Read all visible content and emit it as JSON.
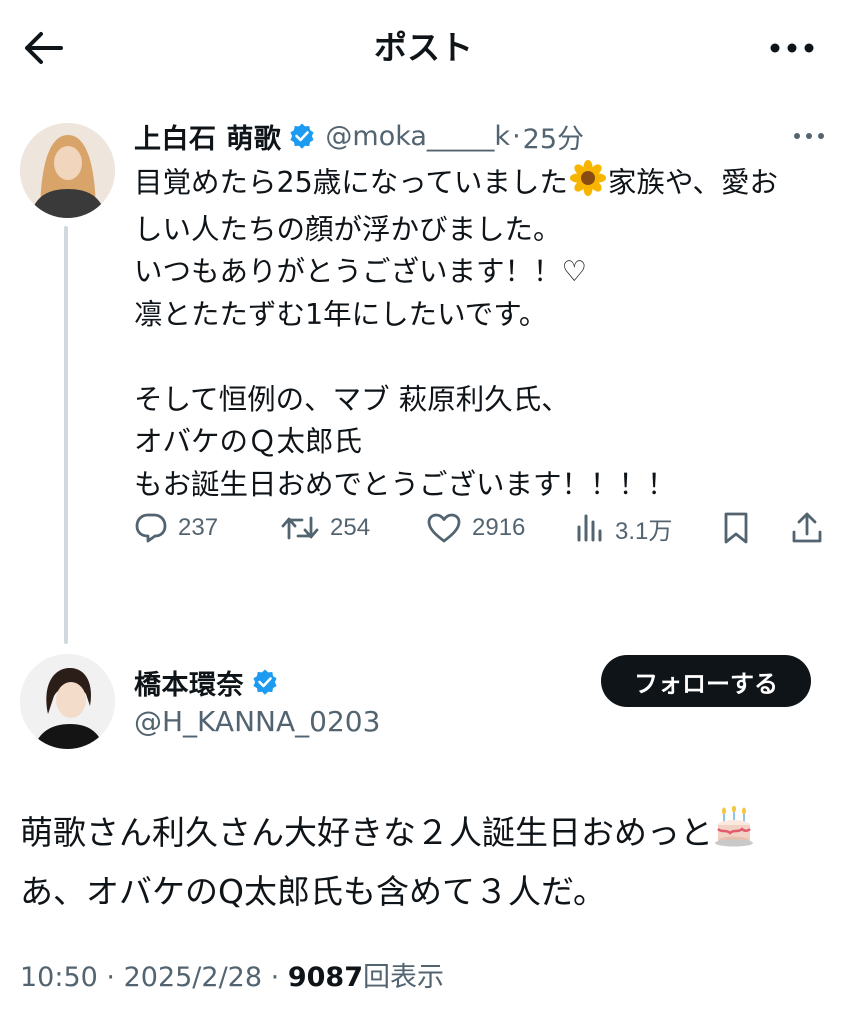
{
  "header": {
    "title": "ポスト",
    "back_icon": "arrow-left-icon",
    "more_icon": "more-horizontal-icon"
  },
  "post": {
    "author": {
      "name": "上白石 萌歌",
      "handle": "@moka_____k",
      "verified": true
    },
    "separator": "·",
    "time": "25分",
    "lines": [
      "目覚めたら25歳になっていました",
      "家族や、愛お",
      "しい人たちの顔が浮かびました。",
      "いつもありがとうございます！！♡",
      "凛とたたずむ1年にしたいです。",
      "そして恒例の、マブ 萩原利久氏、",
      "オバケのＱ太郎氏",
      "もお誕生日おめでとうございます！！！！"
    ],
    "stats": {
      "replies": "237",
      "reposts": "254",
      "likes": "2916",
      "views": "3.1万"
    }
  },
  "reply": {
    "author": {
      "name": "橋本環奈",
      "handle": "@H_KANNA_0203",
      "verified": true
    },
    "follow_label": "フォローする",
    "lines": [
      "萌歌さん利久さん大好きな２人誕生日おめっと",
      "あ、オバケのQ太郎氏も含めて３人だ。"
    ],
    "meta": {
      "time": "10:50",
      "date": "2025/2/28",
      "separator": "·",
      "views": "9087",
      "views_label": "回表示"
    }
  },
  "colors": {
    "text": "#0f1419",
    "secondary": "#536471",
    "verified": "#1d9bf0",
    "thread_line": "#cfd9de",
    "follow_bg": "#0f1419"
  }
}
